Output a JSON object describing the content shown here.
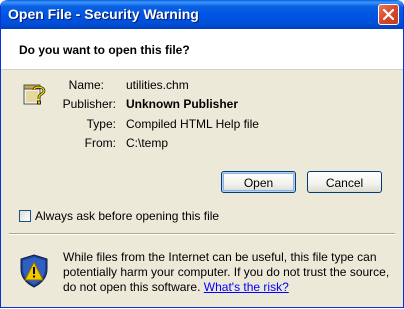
{
  "window": {
    "title": "Open File - Security Warning"
  },
  "dialog": {
    "question": "Do you want to open this file?",
    "fields": {
      "name_label": "Name:",
      "name_value": "utilities.chm",
      "publisher_label": "Publisher:",
      "publisher_value": "Unknown Publisher",
      "type_label": "Type:",
      "type_value": "Compiled HTML Help file",
      "from_label": "From:",
      "from_value": "C:\\temp"
    },
    "buttons": {
      "open": "Open",
      "cancel": "Cancel"
    },
    "checkbox": {
      "label": "Always ask before opening this file",
      "checked": false
    },
    "warning": {
      "text": "While files from the Internet can be useful, this file type can potentially harm your computer. If you do not trust the source, do not open this software. ",
      "link": "What's the risk?"
    }
  },
  "icons": {
    "close": "close-icon",
    "file": "help-file-icon",
    "shield": "security-shield-icon"
  },
  "colors": {
    "titlebar": "#0055e5",
    "dialog_bg": "#ece9d8",
    "link": "#0000ff",
    "shield_yellow": "#f2c700"
  }
}
